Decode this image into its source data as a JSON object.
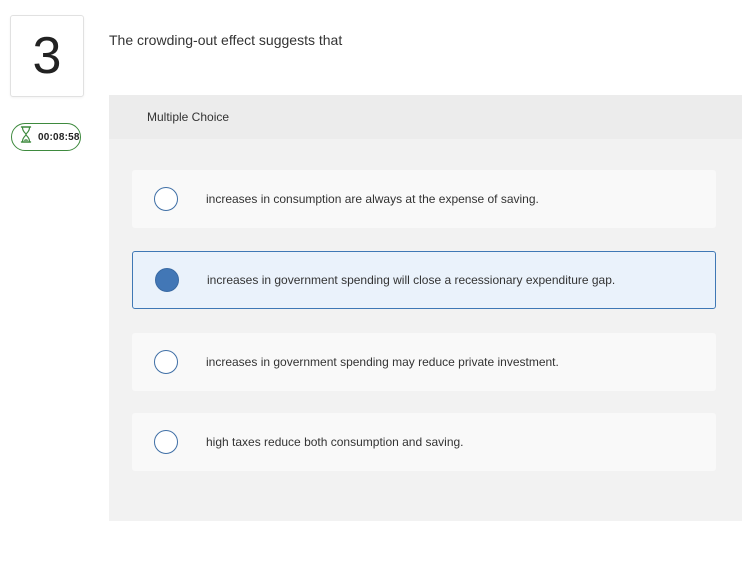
{
  "question": {
    "number": "3",
    "text": "The crowding-out effect suggests that",
    "type_label": "Multiple Choice"
  },
  "timer": {
    "icon": "hourglass-icon",
    "value": "00:08:58",
    "color": "#3e8a3e"
  },
  "options": [
    {
      "text": "increases in consumption are always at the expense of saving.",
      "selected": false
    },
    {
      "text": "increases in government spending will close a recessionary expenditure gap.",
      "selected": true
    },
    {
      "text": "increases in government spending may reduce private investment.",
      "selected": false
    },
    {
      "text": "high taxes reduce both consumption and saving.",
      "selected": false
    }
  ],
  "colors": {
    "accent": "#4277b6",
    "selected_background": "#eaf2fb"
  }
}
